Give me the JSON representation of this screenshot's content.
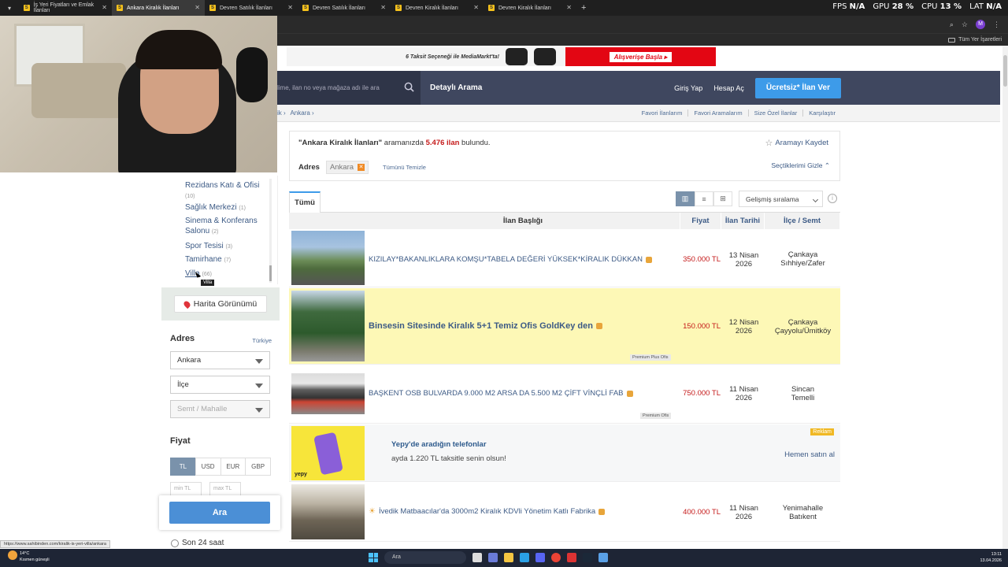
{
  "browser": {
    "tabs": [
      {
        "label": "İş Yeri Fiyatları ve Emlak İlanları",
        "active": false
      },
      {
        "label": "Ankara Kiralık İlanları",
        "active": true
      },
      {
        "label": "Devren Satılık İlanları",
        "active": false
      },
      {
        "label": "Devren Satılık İlanları",
        "active": false
      },
      {
        "label": "Devren Kiralık İlanları",
        "active": false
      },
      {
        "label": "Devren Kiralık İlanları",
        "active": false
      }
    ],
    "perf": {
      "fps_label": "FPS",
      "fps": "N/A",
      "gpu_label": "GPU",
      "gpu": "28 %",
      "cpu_label": "CPU",
      "cpu": "13 %",
      "lat_label": "LAT",
      "lat": "N/A"
    },
    "profile_initial": "M",
    "bookmarks_folder": "Tüm Yer İşaretleri",
    "status_url": "https://www.sahibinden.com/kiralik-is-yeri-villa/ankara"
  },
  "banner": {
    "ad_text": "6 Taksit Seçeneği ile MediaMarkt'ta!",
    "cta": "Alışverişe Başla ▸"
  },
  "header": {
    "search_placeholder": "lime, ilan no veya mağaza adı ile ara",
    "detailed_search": "Detaylı Arama",
    "login": "Giriş Yap",
    "register": "Hesap Aç",
    "post_ad": "Ücretsiz* İlan Ver"
  },
  "subbar": {
    "breadcrumb": [
      "ik ›",
      "Ankara ›"
    ],
    "links": [
      "Favori İlanlarım",
      "Favori Aramalarım",
      "Size Özel İlanlar",
      "Karşılaştır"
    ]
  },
  "sidebar": {
    "categories": [
      {
        "name": "Rezidans Katı & Ofisi",
        "count": "(10)"
      },
      {
        "name": "Sağlık Merkezi",
        "count": "(1)"
      },
      {
        "name": "Sinema & Konferans Salonu",
        "count": "(2)"
      },
      {
        "name": "Spor Tesisi",
        "count": "(3)"
      },
      {
        "name": "Tamirhane",
        "count": "(7)"
      },
      {
        "name": "Villa",
        "count": "(66)"
      }
    ],
    "tooltip": "Villa",
    "map_view": "Harita Görünümü",
    "address_title": "Adres",
    "country_link": "Türkiye",
    "city_select": "Ankara",
    "district_select": "İlçe",
    "neighborhood_select": "Semt / Mahalle",
    "price_title": "Fiyat",
    "currencies": [
      "TL",
      "USD",
      "EUR",
      "GBP"
    ],
    "min_placeholder": "min TL",
    "max_placeholder": "max TL",
    "search_button": "Ara",
    "last24": "Son 24 saat"
  },
  "results": {
    "query": "\"Ankara Kiralık İlanları\"",
    "query_suffix": " aramanızda ",
    "count": "5.476 ilan",
    "found": " bulundu.",
    "save_search": "Aramayı Kaydet",
    "filter_label": "Adres",
    "filter_chip": "Ankara",
    "clear_all": "Tümünü Temizle",
    "hide_selected": "Seçtiklerimi Gizle ⌃",
    "tab_all": "Tümü",
    "sort": "Gelişmiş sıralama"
  },
  "table": {
    "headers": {
      "title": "İlan Başlığı",
      "price": "Fiyat",
      "date": "İlan Tarihi",
      "location": "İlçe / Semt"
    },
    "rows": [
      {
        "title": "KIZILAY*BAKANLIKLARA KOMŞU*TABELA DEĞERİ YÜKSEK*KİRALIK DÜKKAN",
        "price": "350.000 TL",
        "date": "13 Nisan 2026",
        "district": "Çankaya",
        "area": "Sıhhiye/Zafer"
      },
      {
        "title": "Binsesin Sitesinde Kiralık 5+1 Temiz Ofis GoldKey den",
        "price": "150.000 TL",
        "date": "12 Nisan 2026",
        "district": "Çankaya",
        "area": "Çayyolu/Ümitköy",
        "badge": "Premium Plus Ofis"
      },
      {
        "title": "BAŞKENT OSB BULVARDA 9.000 M2 ARSA DA 5.500 M2 ÇİFT VİNÇLİ FAB",
        "price": "750.000 TL",
        "date": "11 Nisan 2026",
        "district": "Sincan",
        "area": "Temelli",
        "badge": "Premium Ofis"
      },
      {
        "title": "İvedik Matbaacılar'da 3000m2 Kiralık KDVli Yönetim Katlı Fabrika",
        "price": "400.000 TL",
        "date": "11 Nisan 2026",
        "district": "Yenimahalle",
        "area": "Batıkent"
      }
    ],
    "ad": {
      "label": "Reklam",
      "title": "Yepy'de aradığın telefonlar",
      "subtitle": "ayda 1.220 TL taksitle senin olsun!",
      "cta": "Hemen satın al",
      "brand": "yepy"
    }
  },
  "taskbar": {
    "temp": "14°C",
    "weather": "Kısmen güneşli",
    "search": "Ara",
    "time": "13:11",
    "date": "13.04.2026"
  }
}
